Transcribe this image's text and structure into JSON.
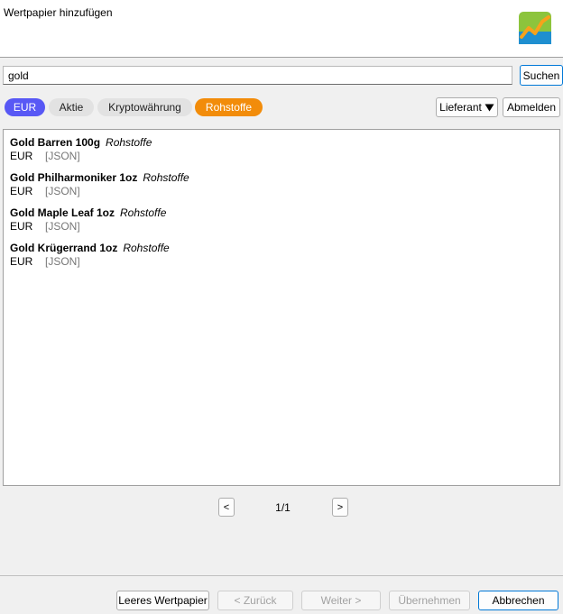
{
  "header": {
    "title": "Wertpapier hinzufügen"
  },
  "search": {
    "value": "gold",
    "button_label": "Suchen"
  },
  "filters": {
    "chips": [
      {
        "label": "EUR",
        "color": "#5858f5",
        "active": true
      },
      {
        "label": "Aktie",
        "color": "#e2e2e2",
        "active": false
      },
      {
        "label": "Kryptowährung",
        "color": "#e2e2e2",
        "active": false
      },
      {
        "label": "Rohstoffe",
        "color": "#f28c0a",
        "active": true
      }
    ],
    "provider_label": "Lieferant",
    "provider_icon": "triangle-down-icon",
    "logout_label": "Abmelden"
  },
  "results": [
    {
      "name": "Gold Barren 100g",
      "type": "Rohstoffe",
      "currency": "EUR",
      "source": "[JSON]"
    },
    {
      "name": "Gold Philharmoniker 1oz",
      "type": "Rohstoffe",
      "currency": "EUR",
      "source": "[JSON]"
    },
    {
      "name": "Gold Maple Leaf 1oz",
      "type": "Rohstoffe",
      "currency": "EUR",
      "source": "[JSON]"
    },
    {
      "name": "Gold Krügerrand 1oz",
      "type": "Rohstoffe",
      "currency": "EUR",
      "source": "[JSON]"
    }
  ],
  "pagination": {
    "prev": "<",
    "page": "1/1",
    "next": ">"
  },
  "footer": {
    "empty_security": "Leeres Wertpapier",
    "back": "< Zurück",
    "next": "Weiter >",
    "apply": "Übernehmen",
    "cancel": "Abbrechen"
  }
}
